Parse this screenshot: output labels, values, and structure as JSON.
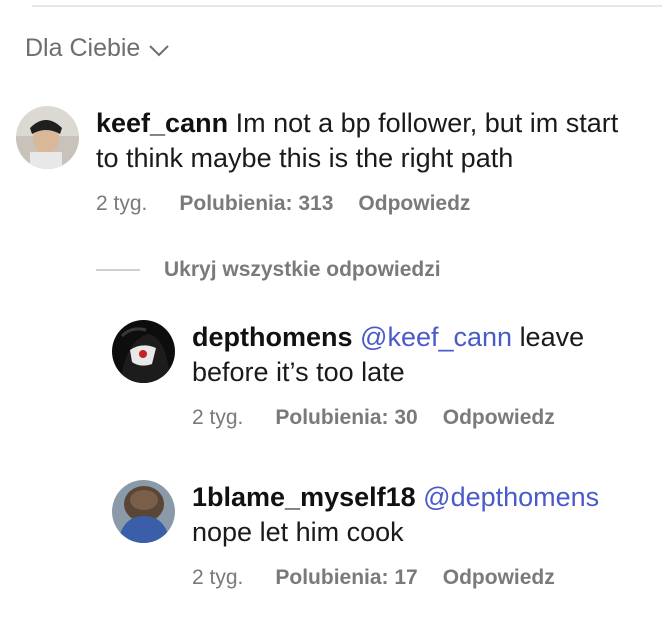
{
  "sort": {
    "label": "Dla Ciebie",
    "icon": "chevron-down-icon"
  },
  "comments": [
    {
      "username": "keef_cann",
      "mention": "",
      "text": "Im not a bp follower, but im start to think maybe this is the right path",
      "time": "2 tyg.",
      "likes": "Polubienia: 313",
      "reply": "Odpowiedz"
    }
  ],
  "hide_replies_label": "Ukryj wszystkie odpowiedzi",
  "replies": [
    {
      "username": "depthomens",
      "mention": "@keef_cann",
      "text": "leave before it’s too late",
      "time": "2 tyg.",
      "likes": "Polubienia: 30",
      "reply": "Odpowiedz"
    },
    {
      "username": "1blame_myself18",
      "mention": "@depthomens",
      "text": "nope let him cook",
      "time": "2 tyg.",
      "likes": "Polubienia: 17",
      "reply": "Odpowiedz"
    }
  ],
  "colors": {
    "mention": "#4a5acb",
    "meta": "#7a7a7a",
    "divider": "#e6e6e6"
  }
}
